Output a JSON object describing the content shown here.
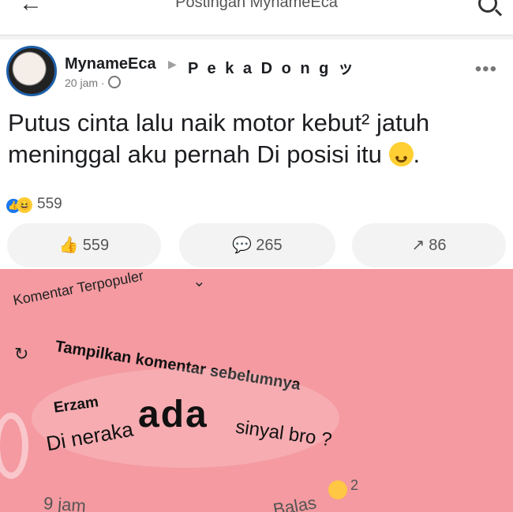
{
  "header": {
    "title": "Postingan MynameEca"
  },
  "post": {
    "author": "MynameEca",
    "group": "P e k a  D o n g ッ",
    "meta": "20 jam ·",
    "text": "Putus cinta lalu naik motor kebut² jatuh meninggal aku pernah Di posisi itu",
    "reaction_count": "559",
    "actions": [
      {
        "label": "559",
        "icon": "like-icon"
      },
      {
        "label": "265",
        "icon": "comment-icon"
      },
      {
        "label": "86",
        "icon": "share-icon"
      }
    ]
  },
  "comments": {
    "sort_label": "Komentar Terpopuler",
    "previous_label": "Tampilkan komentar sebelumnya",
    "item": {
      "author": "Erzam",
      "text_1": "Di neraka",
      "text_2": "ada",
      "text_3": "sinyal bro ?",
      "time": "9 jam",
      "reply": "Balas",
      "reaction_count": "2"
    }
  }
}
